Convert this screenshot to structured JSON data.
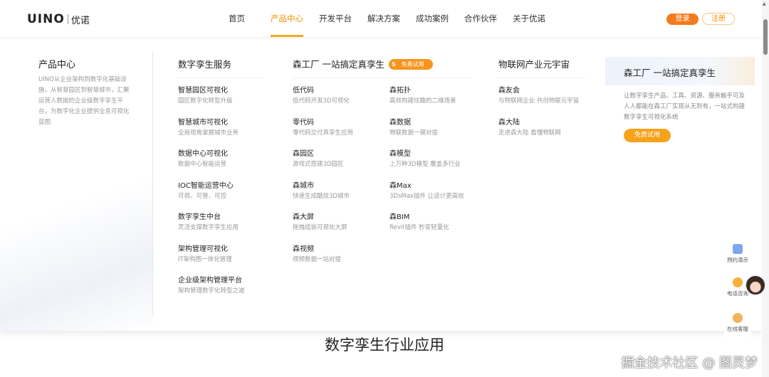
{
  "header": {
    "logo_mark": "UINO",
    "logo_cn": "优诺",
    "nav": [
      "首页",
      "产品中心",
      "开发平台",
      "解决方案",
      "成功案例",
      "合作伙伴",
      "关于优诺"
    ],
    "login": "登录",
    "register": "注册"
  },
  "intro": {
    "title": "产品中心",
    "text": "UINO从企业架构到数字化基础设施，从智慧园区到智慧城市，汇聚运营人数据的企业级数字孪生平台，为数字化企业提供全息可视化蓝图"
  },
  "columns": [
    {
      "title": "数字孪生服务",
      "items": [
        {
          "t": "智慧园区可视化",
          "d": "园区数字化转型升级"
        },
        {
          "t": "智慧城市可视化",
          "d": "全局视角掌握城市业务"
        },
        {
          "t": "数据中心可视化",
          "d": "数据中心智能运营"
        },
        {
          "t": "IOC智能运营中心",
          "d": "可视、可管、可控"
        },
        {
          "t": "数字孪生中台",
          "d": "灵活支撑数字孪生应用"
        },
        {
          "t": "架构管理可视化",
          "d": "IT架构图一体化管理"
        },
        {
          "t": "企业级架构管理平台",
          "d": "架构管理数字化转型之道"
        }
      ]
    },
    {
      "title": "森工厂 一站搞定真孪生",
      "badge": "免费试用",
      "badge_icon": "S",
      "items": [
        {
          "t": "低代码",
          "d": "低代码开发3D可视化"
        },
        {
          "t": "零代码",
          "d": "零代码交付真孪生应用"
        },
        {
          "t": "森园区",
          "d": "游戏式搭建3D园区"
        },
        {
          "t": "森城市",
          "d": "快速生成酷炫3D城市"
        },
        {
          "t": "森大屏",
          "d": "拖拽组装可视化大屏"
        },
        {
          "t": "森视频",
          "d": "视频数据一站对接"
        }
      ]
    },
    {
      "items": [
        {
          "t": "森拓扑",
          "d": "高效构建炫酷的二维场景"
        },
        {
          "t": "森数据",
          "d": "物联数据一键对接"
        },
        {
          "t": "森模型",
          "d": "上万种3D模型 覆盖多行业"
        },
        {
          "t": "森Max",
          "d": "3DsMax插件 让设计更高效"
        },
        {
          "t": "森BIM",
          "d": "Revit插件 秒变轻量化"
        }
      ]
    },
    {
      "title": "物联网产业元宇宙",
      "items": [
        {
          "t": "森友会",
          "d": "与物联网企业 共创物联元宇宙"
        },
        {
          "t": "森大陆",
          "d": "走进森大陆 看懂物联网"
        }
      ]
    }
  ],
  "card": {
    "title": "森工厂 一站搞定真孪生",
    "text1": "让数字孪生产品、工具、资源、服务触手可及",
    "text2": "人人都能在森工厂实现从无到有，一站式构建数字孪生可视化系统",
    "button": "免费试用"
  },
  "section_title": "数字孪生行业应用",
  "side": [
    "预约演示",
    "电话咨询",
    "在线客服"
  ],
  "watermark": "掘金技术社区 @ 图灵梦"
}
